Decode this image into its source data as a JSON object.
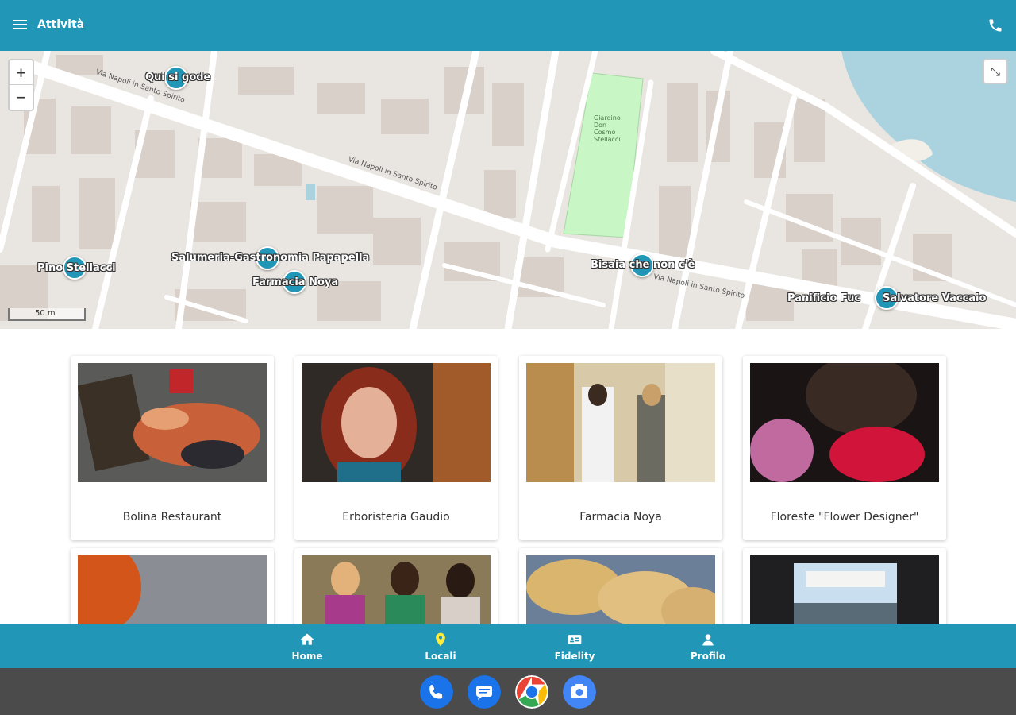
{
  "appbar": {
    "title": "Attività",
    "menu_icon": "menu-icon",
    "phone_icon": "phone-icon"
  },
  "map": {
    "zoom_in": "+",
    "zoom_out": "−",
    "scale_label": "50 m",
    "fullscreen_icon": "exit-fullscreen-icon",
    "markers": [
      {
        "label": "Qui si gode"
      },
      {
        "label": "Pino Stellacci"
      },
      {
        "label": "Salumeria-Gastronomia Papapella"
      },
      {
        "label": "Farmacia Noya"
      },
      {
        "label": "Bisaia che non c'è"
      },
      {
        "label": "Panificio Fuc"
      },
      {
        "label": "Salvatore Vaccaio"
      }
    ],
    "streets": [
      "Via Napoli in Santo Spirito",
      "Via Napoli in Santo Spirito",
      "Via Napoli in Santo Spirito",
      "Giardino Don Cosmo Stellacci"
    ]
  },
  "cards": [
    {
      "name": "Bolina Restaurant"
    },
    {
      "name": "Erboristeria Gaudio"
    },
    {
      "name": "Farmacia Noya"
    },
    {
      "name": "Floreste \"Flower Designer\""
    },
    {
      "name": ""
    },
    {
      "name": ""
    },
    {
      "name": ""
    },
    {
      "name": ""
    }
  ],
  "bottom_nav": [
    {
      "label": "Home",
      "icon": "home-icon",
      "color": "#ffffff"
    },
    {
      "label": "Locali",
      "icon": "location-pin-icon",
      "color": "#ffeb3b"
    },
    {
      "label": "Fidelity",
      "icon": "id-card-icon",
      "color": "#ffffff"
    },
    {
      "label": "Profilo",
      "icon": "person-icon",
      "color": "#ffffff"
    }
  ],
  "dock": [
    {
      "icon": "phone-app-icon"
    },
    {
      "icon": "messages-app-icon"
    },
    {
      "icon": "chrome-app-icon"
    },
    {
      "icon": "camera-app-icon"
    }
  ],
  "colors": {
    "brand": "#2196b7",
    "active_nav": "#ffeb3b",
    "dock": "#4b4b4b"
  }
}
